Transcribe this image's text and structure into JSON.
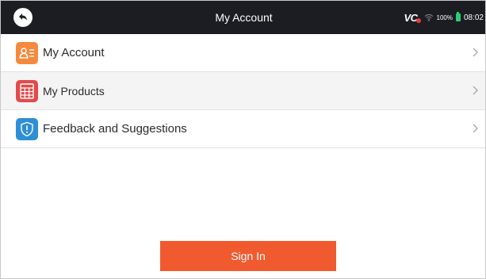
{
  "header": {
    "title": "My Account",
    "vci_label": "VC",
    "battery_percent": "100%",
    "time": "08:02"
  },
  "menu": {
    "items": [
      {
        "label": "My Account",
        "icon": "account-list-icon",
        "color": "#f58a3c"
      },
      {
        "label": "My Products",
        "icon": "products-grid-icon",
        "color": "#e24a4a"
      },
      {
        "label": "Feedback and Suggestions",
        "icon": "feedback-shield-icon",
        "color": "#2e8fd6"
      }
    ]
  },
  "signin": {
    "label": "Sign In",
    "color": "#f15a2f"
  }
}
